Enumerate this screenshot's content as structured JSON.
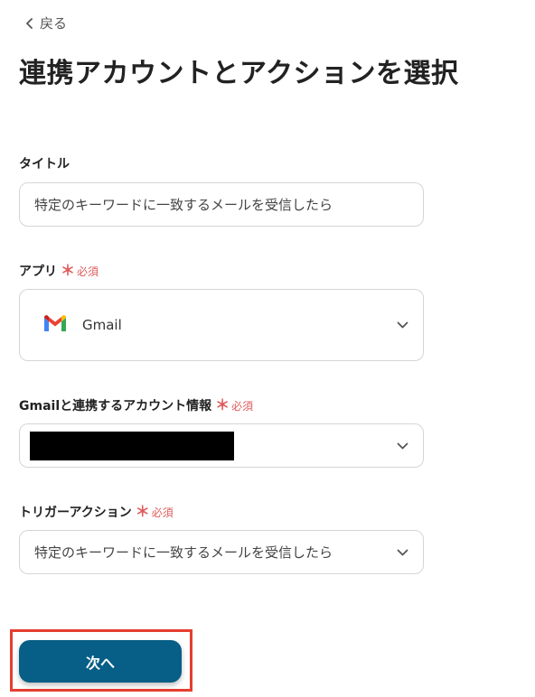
{
  "header": {
    "back_label": "戻る",
    "title": "連携アカウントとアクションを選択"
  },
  "form": {
    "title_field": {
      "label": "タイトル",
      "value": "特定のキーワードに一致するメールを受信したら"
    },
    "app_field": {
      "label": "アプリ",
      "required_mark": "＊",
      "required_text": "必須",
      "value": "Gmail",
      "icon": "gmail-logo"
    },
    "account_field": {
      "label": "Gmailと連携するアカウント情報",
      "required_mark": "＊",
      "required_text": "必須",
      "value_redacted": true
    },
    "trigger_field": {
      "label": "トリガーアクション",
      "required_mark": "＊",
      "required_text": "必須",
      "value": "特定のキーワードに一致するメールを受信したら"
    }
  },
  "footer": {
    "next_label": "次へ"
  },
  "colors": {
    "primary_button": "#075e86",
    "required": "#e05a5a",
    "highlight": "#e53e30"
  }
}
